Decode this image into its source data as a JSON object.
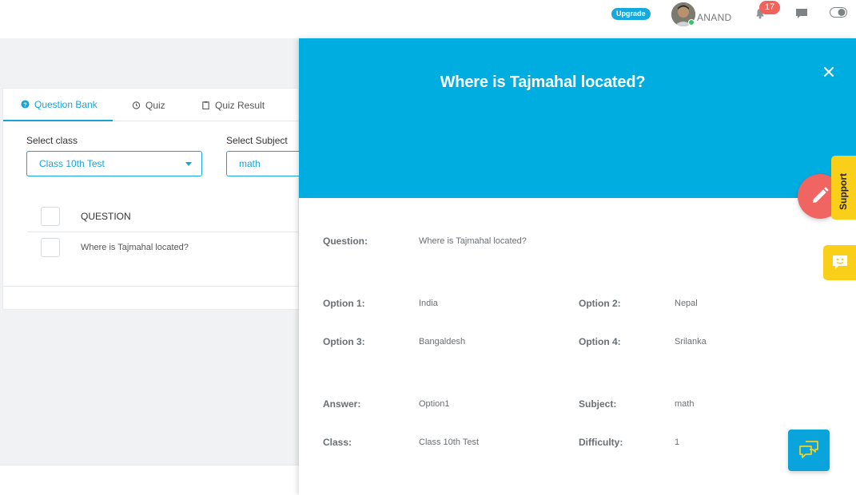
{
  "topbar": {
    "upgrade_label": "Upgrade",
    "username": "ANAND",
    "notification_count": "17"
  },
  "tabs": [
    {
      "label": "Question Bank",
      "icon": "question-circle-icon",
      "active": true
    },
    {
      "label": "Quiz",
      "icon": "alarm-clock-icon",
      "active": false
    },
    {
      "label": "Quiz Result",
      "icon": "clipboard-icon",
      "active": false
    }
  ],
  "filters": {
    "class_label": "Select class",
    "class_value": "Class 10th Test",
    "subject_label": "Select Subject",
    "subject_value": "math"
  },
  "table": {
    "header": "QUESTION",
    "rows": [
      "Where is Tajmahal located?"
    ]
  },
  "panel": {
    "title": "Where is Tajmahal located?",
    "question_label": "Question:",
    "question_value": "Where is Tajmahal located?",
    "option1_label": "Option 1:",
    "option1_value": "India",
    "option2_label": "Option 2:",
    "option2_value": "Nepal",
    "option3_label": "Option 3:",
    "option3_value": "Bangaldesh",
    "option4_label": "Option 4:",
    "option4_value": "Srilanka",
    "answer_label": "Answer:",
    "answer_value": "Option1",
    "subject_label": "Subject:",
    "subject_value": "math",
    "class_label": "Class:",
    "class_value": "Class 10th Test",
    "difficulty_label": "Difficulty:",
    "difficulty_value": "1"
  },
  "widgets": {
    "support_label": "Support"
  },
  "colors": {
    "accent": "#00ade0",
    "badge": "#f0635d",
    "support": "#f9cf1a",
    "edit_fab": "#f06561"
  }
}
